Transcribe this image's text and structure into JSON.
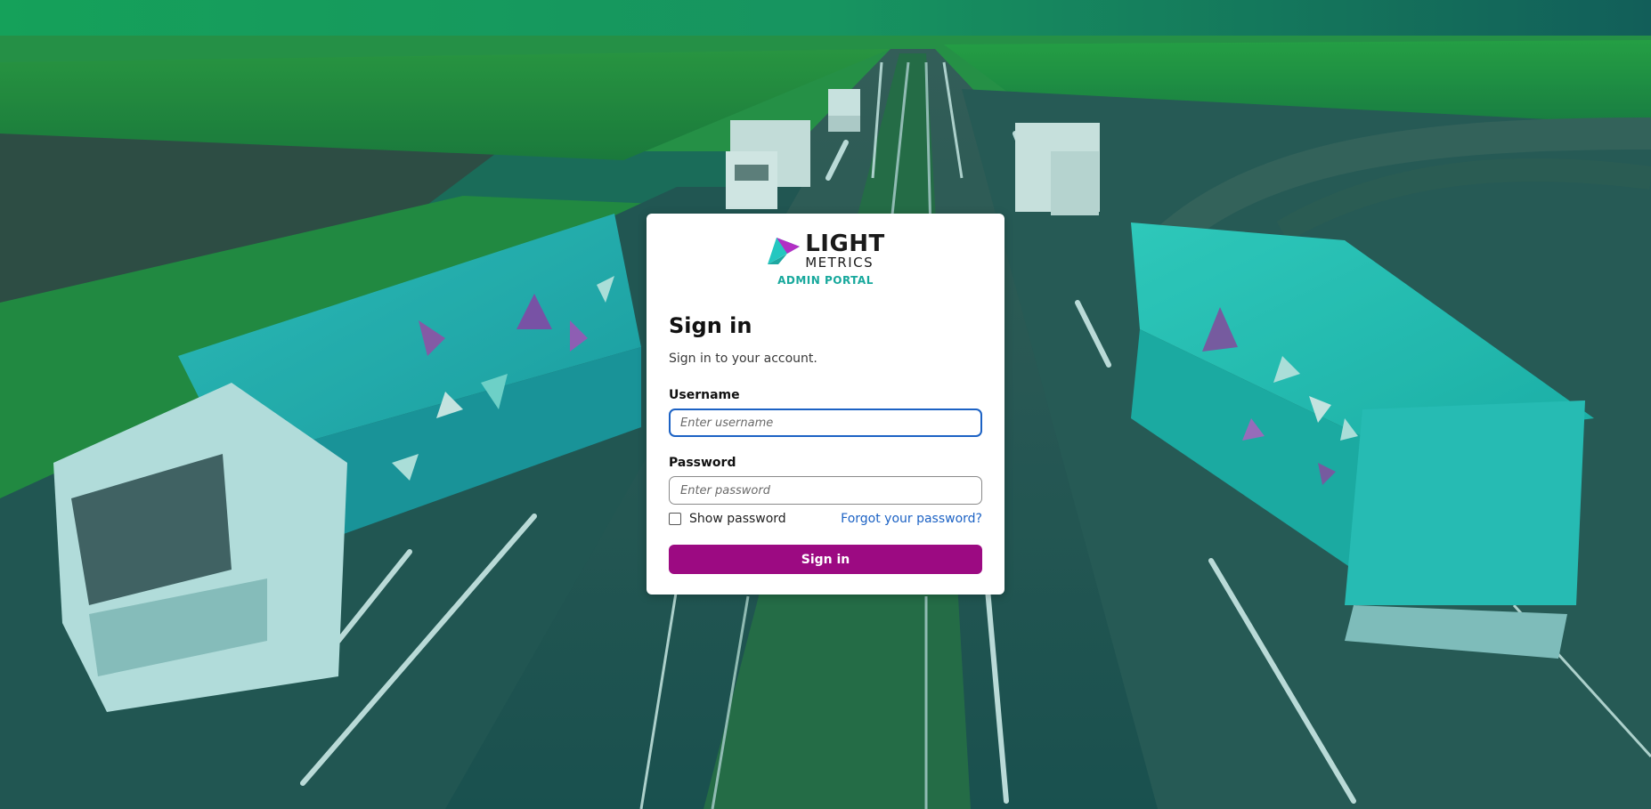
{
  "brand": {
    "name_top": "LIGHT",
    "name_bottom": "METRICS",
    "portal": "ADMIN PORTAL"
  },
  "form": {
    "title": "Sign in",
    "subtitle": "Sign in to your account.",
    "username_label": "Username",
    "username_placeholder": "Enter username",
    "username_value": "",
    "password_label": "Password",
    "password_placeholder": "Enter password",
    "password_value": "",
    "show_password_label": "Show password",
    "show_password_checked": false,
    "forgot_link": "Forgot your password?",
    "submit_label": "Sign in"
  },
  "colors": {
    "accent": "#9c0a82",
    "link": "#1c62c4",
    "brand_teal": "#17a89c",
    "focus": "#1c62c4"
  },
  "background": {
    "icon": "highway-trucks-image"
  }
}
